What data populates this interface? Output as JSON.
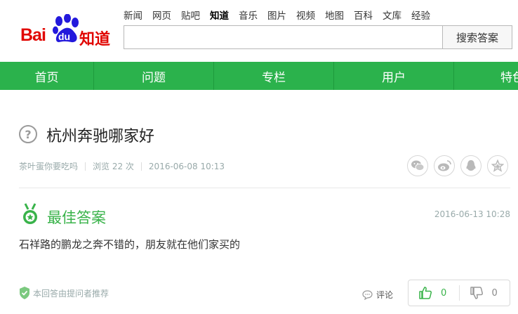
{
  "header": {
    "logo": {
      "bai": "Bai",
      "du": "du",
      "zhidao": "知道"
    },
    "topnav": [
      "新闻",
      "网页",
      "贴吧",
      "知道",
      "音乐",
      "图片",
      "视频",
      "地图",
      "百科",
      "文库",
      "经验"
    ],
    "topnav_active": "知道",
    "search": {
      "value": "",
      "placeholder": "",
      "button_label": "搜索答案"
    }
  },
  "greennav": [
    "首页",
    "问题",
    "专栏",
    "用户",
    "特色"
  ],
  "question": {
    "title": "杭州奔驰哪家好",
    "author": "茶叶蛋你要吃吗",
    "views": "浏览 22 次",
    "date": "2016-06-08 10:13"
  },
  "share_icons": [
    "wechat-icon",
    "weibo-icon",
    "qq-icon",
    "star-icon"
  ],
  "answer": {
    "label": "最佳答案",
    "time": "2016-06-13 10:28",
    "text": "石祥路的鹏龙之奔不错的，朋友就在他们家买的",
    "recommend": "本回答由提问者推荐",
    "comment_label": "评论",
    "upvotes": "0",
    "downvotes": "0"
  },
  "colors": {
    "brand_red": "#e10602",
    "brand_blue": "#2319dc",
    "green": "#2bb24c",
    "answer_green": "#39b34a"
  }
}
